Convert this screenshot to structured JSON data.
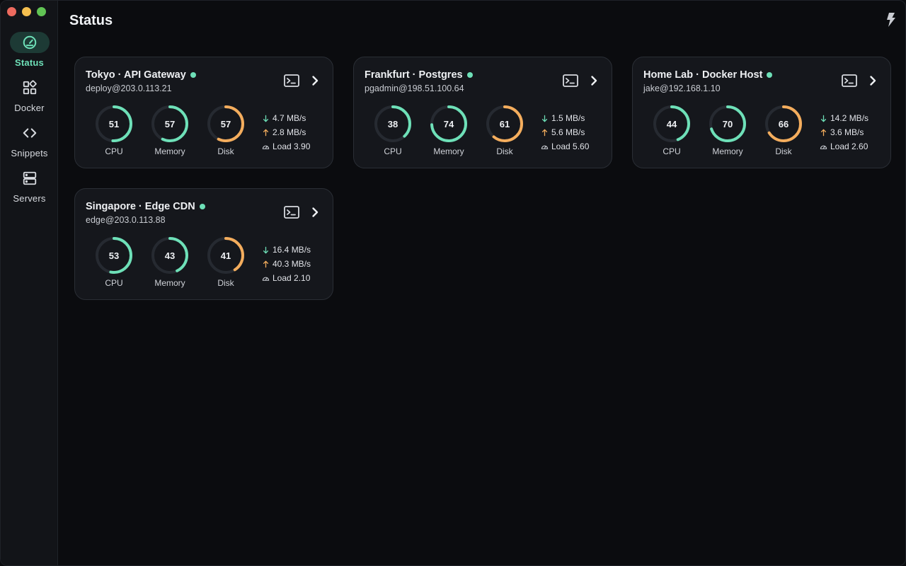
{
  "page": {
    "title": "Status"
  },
  "sidebar": {
    "items": [
      {
        "label": "Status",
        "icon": "gauge-icon",
        "active": true
      },
      {
        "label": "Docker",
        "icon": "docker-grid-icon",
        "active": false
      },
      {
        "label": "Snippets",
        "icon": "code-brackets-icon",
        "active": false
      },
      {
        "label": "Servers",
        "icon": "server-stack-icon",
        "active": false
      }
    ]
  },
  "colors": {
    "accent": "#6ee0b8",
    "disk": "#f4ad5d",
    "track": "#262a31",
    "upload": "#f4ad5d"
  },
  "servers": [
    {
      "name": "Tokyo · API Gateway",
      "login": "deploy@203.0.113.21",
      "cpu": 51,
      "memory": 57,
      "disk": 57,
      "down": "4.7 MB/s",
      "up": "2.8 MB/s",
      "load": "Load 3.90"
    },
    {
      "name": "Frankfurt · Postgres",
      "login": "pgadmin@198.51.100.64",
      "cpu": 38,
      "memory": 74,
      "disk": 61,
      "down": "1.5 MB/s",
      "up": "5.6 MB/s",
      "load": "Load 5.60"
    },
    {
      "name": "Home Lab · Docker Host",
      "login": "jake@192.168.1.10",
      "cpu": 44,
      "memory": 70,
      "disk": 66,
      "down": "14.2 MB/s",
      "up": "3.6 MB/s",
      "load": "Load 2.60"
    },
    {
      "name": "Singapore · Edge CDN",
      "login": "edge@203.0.113.88",
      "cpu": 53,
      "memory": 43,
      "disk": 41,
      "down": "16.4 MB/s",
      "up": "40.3 MB/s",
      "load": "Load 2.10"
    }
  ],
  "labels": {
    "cpu": "CPU",
    "memory": "Memory",
    "disk": "Disk"
  }
}
